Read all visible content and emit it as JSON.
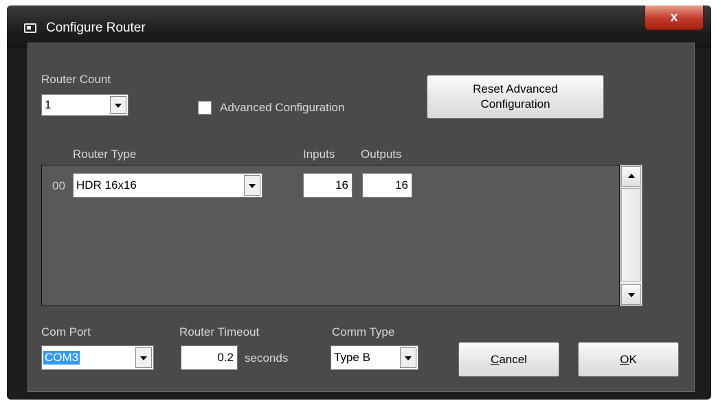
{
  "window": {
    "title": "Configure Router",
    "close_label": "x"
  },
  "router_count": {
    "label": "Router Count",
    "value": "1"
  },
  "advanced": {
    "checkbox_label": "Advanced Configuration",
    "checked": false,
    "reset_button_line1": "Reset Advanced",
    "reset_button_line2": "Configuration"
  },
  "routers_table": {
    "headers": {
      "router_type": "Router Type",
      "inputs": "Inputs",
      "outputs": "Outputs"
    },
    "rows": [
      {
        "index": "00",
        "router_type": "HDR 16x16",
        "inputs": "16",
        "outputs": "16"
      }
    ]
  },
  "com_port": {
    "label": "Com Port",
    "value": "COM3"
  },
  "router_timeout": {
    "label": "Router Timeout",
    "value": "0.2",
    "unit": "seconds"
  },
  "comm_type": {
    "label": "Comm Type",
    "value": "Type B"
  },
  "buttons": {
    "cancel_accel": "C",
    "cancel_rest": "ancel",
    "ok_accel": "O",
    "ok_rest": "K"
  },
  "colors": {
    "client_bg": "#4a4a4a",
    "list_bg": "#595959",
    "selection": "#3399ff",
    "close_button": "#c0392b"
  },
  "icons": [
    "app-window-icon",
    "close-icon",
    "chevron-down-icon",
    "scroll-up-icon",
    "scroll-down-icon"
  ]
}
